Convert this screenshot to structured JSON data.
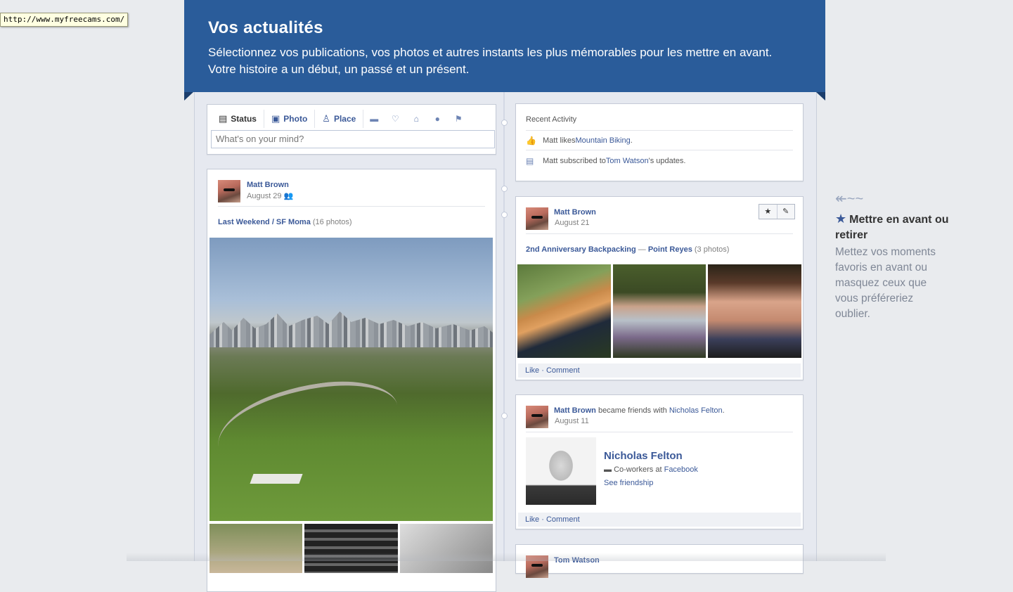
{
  "tooltip": "http://www.myfreecams.com/",
  "banner": {
    "title": "Vos actualités",
    "text": "Sélectionnez vos publications, vos photos et autres instants les plus mémorables pour les mettre en avant. Votre histoire a un début, un passé et un présent."
  },
  "composer": {
    "tabs": [
      {
        "label": "Status",
        "icon": "status-icon"
      },
      {
        "label": "Photo",
        "icon": "photo-icon"
      },
      {
        "label": "Place",
        "icon": "place-icon"
      }
    ],
    "extra_icons": [
      "briefcase-icon",
      "heart-icon",
      "house-icon",
      "apple-icon",
      "flag-icon"
    ],
    "placeholder": "What's on your mind?"
  },
  "post_left": {
    "author": "Matt Brown",
    "date": "August 29",
    "album": "Last Weekend / SF Moma",
    "album_count": "(16 photos)"
  },
  "recent_activity": {
    "title": "Recent Activity",
    "items": [
      {
        "prefix": "Matt likes ",
        "link": "Mountain Biking",
        "suffix": "."
      },
      {
        "prefix": "Matt subscribed to ",
        "link": "Tom Watson",
        "suffix": "'s updates."
      }
    ]
  },
  "post_right1": {
    "author": "Matt Brown",
    "date": "August 21",
    "album": "2nd Anniversary Backpacking",
    "separator": " — ",
    "place": "Point Reyes",
    "album_count": "(3 photos)",
    "actions": "Like · Comment",
    "controls": [
      "★",
      "✎"
    ]
  },
  "post_right2": {
    "author": "Matt Brown",
    "middle": " became friends with ",
    "friend": "Nicholas Felton",
    "end": ".",
    "date": "August 11",
    "friend_name": "Nicholas Felton",
    "friend_meta_prefix": "Co-workers at ",
    "friend_meta_link": "Facebook",
    "see_friendship": "See friendship",
    "actions": "Like · Comment"
  },
  "post_right3": {
    "author": "Tom Watson"
  },
  "hint": {
    "title": "Mettre en avant ou retirer",
    "text": "Mettez vos moments favoris en avant ou masquez ceux que vous préféreriez oublier."
  }
}
